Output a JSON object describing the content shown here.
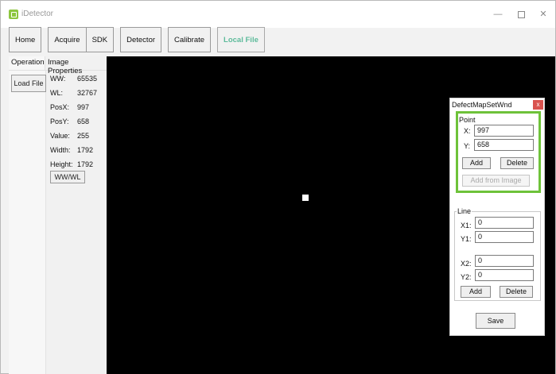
{
  "window": {
    "title": "iDetector"
  },
  "toolbar": {
    "buttons": [
      "Home",
      "Acquire",
      "SDK",
      "Detector",
      "Calibrate",
      "Local File"
    ],
    "active": "Local File"
  },
  "left_panel": {
    "tabs": [
      "Operation",
      "Image Properties"
    ],
    "load_file_label": "Load File",
    "props": [
      {
        "key": "WW:",
        "value": "65535"
      },
      {
        "key": "WL:",
        "value": "32767"
      },
      {
        "key": "PosX:",
        "value": "997"
      },
      {
        "key": "PosY:",
        "value": "658"
      },
      {
        "key": "Value:",
        "value": "255"
      },
      {
        "key": "Width:",
        "value": "1792"
      },
      {
        "key": "Height:",
        "value": "1792"
      }
    ],
    "wwwl_label": "WW/WL"
  },
  "defect_map": {
    "title": "DefectMapSetWnd",
    "point": {
      "group_label": "Point",
      "x_label": "X:",
      "x_value": "997",
      "y_label": "Y:",
      "y_value": "658",
      "add_label": "Add",
      "delete_label": "Delete",
      "add_from_image_label": "Add from Image"
    },
    "line": {
      "group_label": "Line",
      "x1_label": "X1:",
      "x1_value": "0",
      "y1_label": "Y1:",
      "y1_value": "0",
      "x2_label": "X2:",
      "x2_value": "0",
      "y2_label": "Y2:",
      "y2_value": "0",
      "add_label": "Add",
      "delete_label": "Delete"
    },
    "save_label": "Save"
  },
  "colors": {
    "active_tab": "#5dbb9b",
    "highlight_border": "#6ec23a",
    "close_button": "#d9534f",
    "image_background": "#000000"
  }
}
